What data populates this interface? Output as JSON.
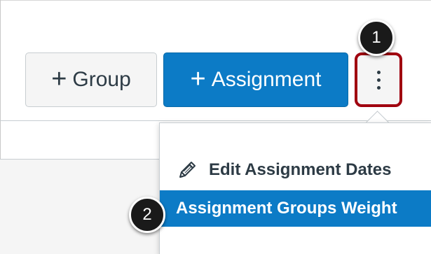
{
  "toolbar": {
    "group_button": {
      "icon": "plus-icon",
      "label": "Group"
    },
    "assignment_button": {
      "icon": "plus-icon",
      "label": "Assignment"
    },
    "options_button": {
      "icon": "kebab-menu-icon"
    }
  },
  "callouts": {
    "first": "1",
    "second": "2"
  },
  "menu": {
    "items": [
      {
        "icon": "pencil-icon",
        "label": "Edit Assignment Dates",
        "highlighted": false
      },
      {
        "icon": "",
        "label": "Assignment Groups Weight",
        "highlighted": true
      }
    ]
  },
  "colors": {
    "primary_blue": "#0c7bc6",
    "callout_border_red": "#a0000f",
    "text_dark": "#2d3b45",
    "button_gray": "#f5f5f5"
  }
}
